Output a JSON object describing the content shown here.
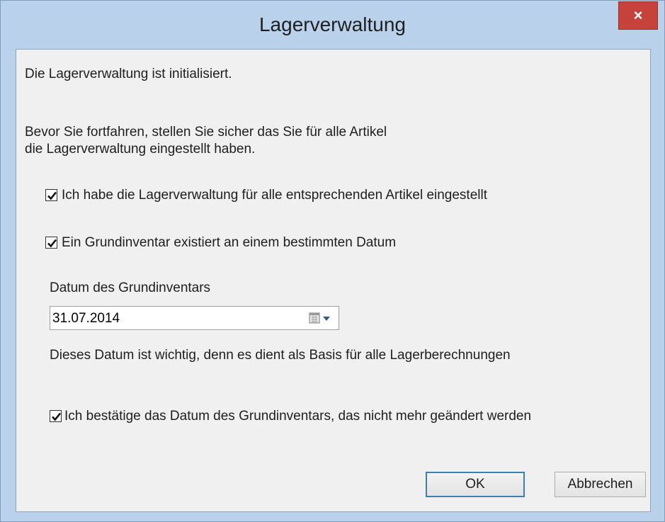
{
  "window": {
    "title": "Lagerverwaltung",
    "close_label": "×"
  },
  "content": {
    "intro": "Die Lagerverwaltung ist initialisiert.",
    "warning_line1": "Bevor Sie fortfahren, stellen Sie sicher das Sie für alle Artikel",
    "warning_line2": "die Lagerverwaltung eingestellt haben."
  },
  "checkboxes": [
    {
      "label": "Ich habe die Lagerverwaltung für alle entsprechenden Artikel eingestellt",
      "checked": true
    },
    {
      "label": "Ein Grundinventar existiert an einem bestimmten Datum",
      "checked": true
    },
    {
      "label": "Ich bestätige das Datum des Grundinventars, das nicht mehr geändert werden",
      "checked": true
    }
  ],
  "date_field": {
    "label": "Datum des Grundinventars",
    "value": "31.07.2014",
    "icon": "calendar-dropdown-icon",
    "hint": "Dieses Datum ist wichtig, denn es dient als Basis für alle Lagerberechnungen"
  },
  "buttons": {
    "ok_label": "OK",
    "cancel_label": "Abbrechen"
  },
  "colors": {
    "titlebar": "#b9d1ea",
    "close_button": "#c7423a",
    "client_background": "#f0f0f0",
    "default_button_border": "#3c7fb1"
  }
}
